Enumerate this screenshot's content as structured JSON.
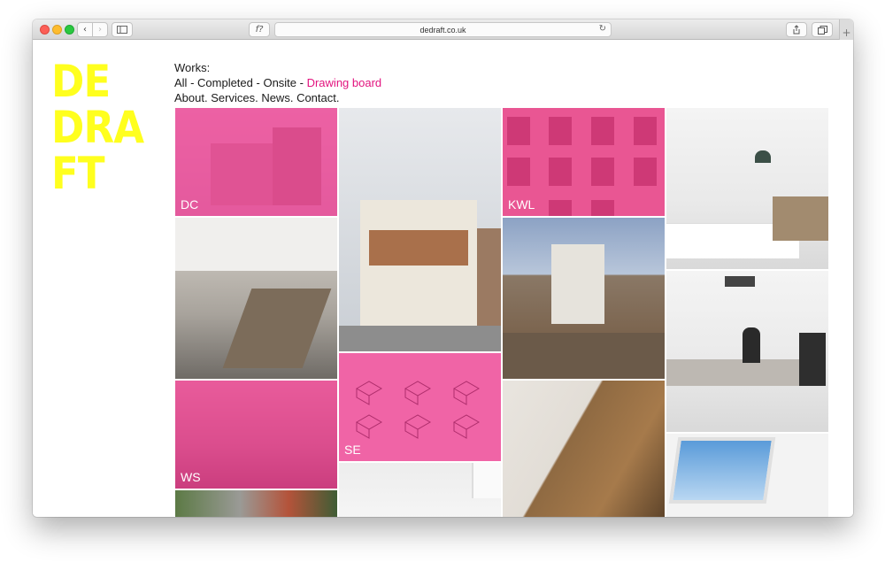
{
  "browser": {
    "url": "dedraft.co.uk",
    "reader_icon": "f?",
    "back_icon": "chevron-left-icon",
    "forward_icon": "chevron-right-icon",
    "reload_icon": "reload-icon",
    "new_tab_icon": "plus-icon"
  },
  "site": {
    "logo_lines": [
      "DE",
      "DRA",
      "FT"
    ],
    "logo_color": "#ffff1e",
    "accent_color": "#e2137e",
    "menu": {
      "works_label": "Works:",
      "filters": [
        {
          "label": "All",
          "sep": " - "
        },
        {
          "label": "Completed",
          "sep": " - "
        },
        {
          "label": "Onsite",
          "sep": " - "
        },
        {
          "label": "Drawing board",
          "sep": ""
        }
      ],
      "pages": [
        "About.",
        "Services.",
        "News.",
        "Contact."
      ]
    },
    "tiles": [
      {
        "label": "DC"
      },
      {
        "label": "KWL"
      },
      {
        "label": "WS"
      },
      {
        "label": "SE"
      }
    ]
  }
}
